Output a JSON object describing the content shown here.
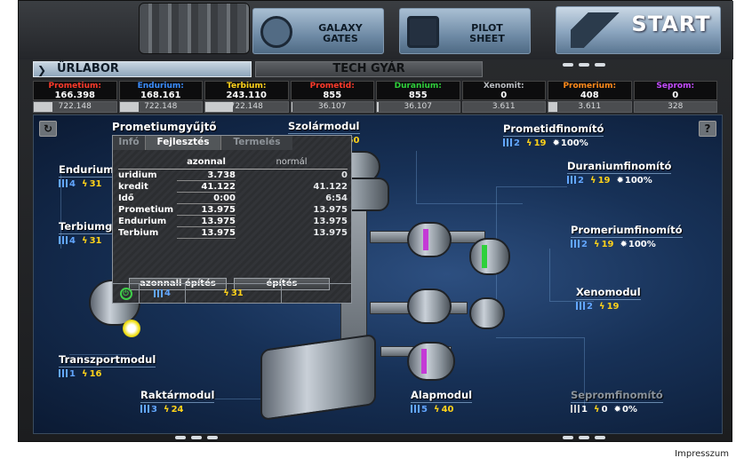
{
  "topbar": {
    "galaxy_label": "GALAXY\nGATES",
    "pilot_label": "PILOT\nSHEET",
    "start_label": "START"
  },
  "tabs": {
    "urlabor": "ÜRLABOR",
    "techgyar": "TECH GYÁR"
  },
  "resources": [
    {
      "name": "Prometium:",
      "value": "166.398",
      "capacity": "722.148",
      "fill": 0.23,
      "color": "#ff3a2a"
    },
    {
      "name": "Endurium:",
      "value": "168.161",
      "capacity": "722.148",
      "fill": 0.23,
      "color": "#3a8dff"
    },
    {
      "name": "Terbium:",
      "value": "243.110",
      "capacity": "722.148",
      "fill": 0.34,
      "color": "#ffd21a"
    },
    {
      "name": "Prometid:",
      "value": "855",
      "capacity": "36.107",
      "fill": 0.02,
      "color": "#ff3a2a"
    },
    {
      "name": "Duranium:",
      "value": "855",
      "capacity": "36.107",
      "fill": 0.02,
      "color": "#2fd13b"
    },
    {
      "name": "Xenomit:",
      "value": "0",
      "capacity": "3.611",
      "fill": 0.0,
      "color": "#b9bcc0"
    },
    {
      "name": "Promerium:",
      "value": "408",
      "capacity": "3.611",
      "fill": 0.11,
      "color": "#ff8a1a"
    },
    {
      "name": "Seprom:",
      "value": "0",
      "capacity": "328",
      "fill": 0.0,
      "color": "#c44bff"
    }
  ],
  "popup": {
    "title": "Prometiumgyűjtő",
    "tabs": [
      "Infó",
      "Fejlesztés",
      "Termelés"
    ],
    "col_instant": "azonnal",
    "col_normal": "normál",
    "rows": [
      {
        "label": "uridium",
        "instant": "3.738",
        "normal": "0"
      },
      {
        "label": "kredit",
        "instant": "41.122",
        "normal": "41.122"
      },
      {
        "label": "Idő",
        "instant": "0:00",
        "normal": "6:54"
      },
      {
        "label": "Prometium",
        "instant": "13.975",
        "normal": "13.975"
      },
      {
        "label": "Endurium",
        "instant": "13.975",
        "normal": "13.975"
      },
      {
        "label": "Terbium",
        "instant": "13.975",
        "normal": "13.975"
      }
    ],
    "btn_instant": "azonnali építés",
    "btn_build": "építés",
    "footer_level": "4",
    "footer_energy": "31"
  },
  "modules": {
    "szolar": {
      "name": "Szolármodul",
      "energy": "249 / 350"
    },
    "endurium": {
      "name": "Endurium",
      "level": "4",
      "energy": "31"
    },
    "terbium": {
      "name": "Terbiumg",
      "level": "4",
      "energy": "31"
    },
    "transzport": {
      "name": "Transzportmodul",
      "level": "1",
      "energy": "16"
    },
    "raktar": {
      "name": "Raktármodul",
      "level": "3",
      "energy": "24"
    },
    "alap": {
      "name": "Alapmodul",
      "level": "5",
      "energy": "40"
    },
    "prometid": {
      "name": "Prometidfinomító",
      "level": "2",
      "energy": "19",
      "percent": "100%"
    },
    "duranium": {
      "name": "Duraniumfinomító",
      "level": "2",
      "energy": "19",
      "percent": "100%"
    },
    "promerium": {
      "name": "Promeriumfinomító",
      "level": "2",
      "energy": "19",
      "percent": "100%"
    },
    "xeno": {
      "name": "Xenomodul",
      "level": "2",
      "energy": "19"
    },
    "seprom": {
      "name": "Sepromfinomító",
      "level": "1",
      "energy": "0",
      "percent": "0%"
    }
  },
  "buttons": {
    "refresh_icon": "↻",
    "help_label": "?"
  },
  "footer": {
    "impresszum": "Impresszum"
  }
}
